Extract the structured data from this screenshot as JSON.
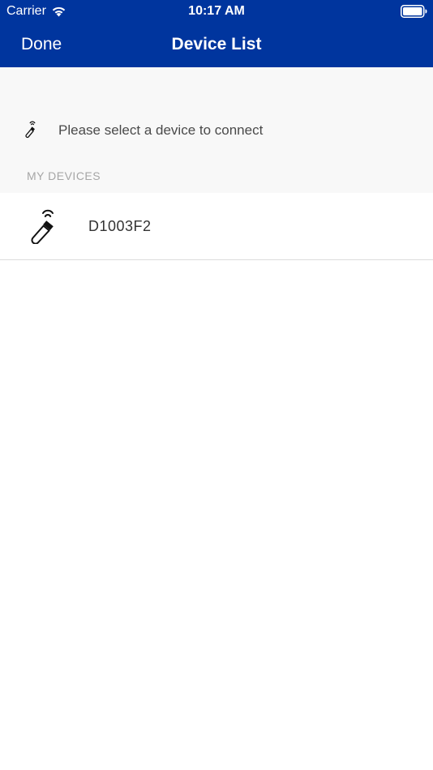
{
  "status_bar": {
    "carrier": "Carrier",
    "time": "10:17 AM",
    "icons": [
      "wifi-icon",
      "battery-icon"
    ]
  },
  "nav": {
    "done_label": "Done",
    "title": "Device List"
  },
  "prompt": {
    "text": "Please select a device to connect",
    "icon": "usb-wireless-dongle-icon"
  },
  "my_devices": {
    "header": "MY DEVICES",
    "items": [
      {
        "name": "D1003F2",
        "icon": "usb-wireless-dongle-icon"
      }
    ]
  },
  "colors": {
    "brand": "#00359e",
    "background_grouped": "#f8f8f8",
    "section_header": "#a6a6a6",
    "separator": "#dcdcdc"
  }
}
